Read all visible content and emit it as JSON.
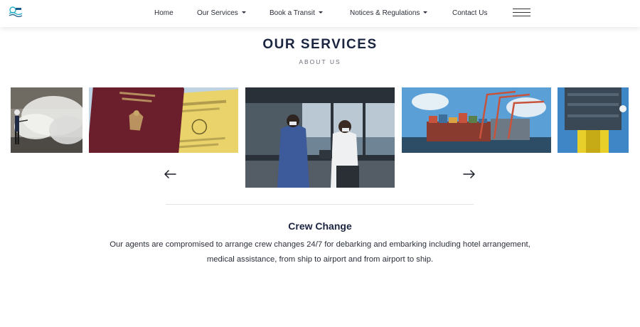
{
  "nav": {
    "home": "Home",
    "services": "Our Services",
    "book": "Book a Transit",
    "notices": "Notices & Regulations",
    "contact": "Contact Us"
  },
  "section": {
    "title": "OUR SERVICES",
    "subtitle": "ABOUT US"
  },
  "carousel": {
    "slides": [
      {
        "subject": "fumigation-worker"
      },
      {
        "subject": "passports-documents"
      },
      {
        "subject": "crew-on-bridge",
        "active": true
      },
      {
        "subject": "container-ship-port"
      },
      {
        "subject": "offshore-rig"
      }
    ]
  },
  "service": {
    "title": "Crew Change",
    "description": "Our agents are compromised to arrange crew changes 24/7 for debarking and embarking including hotel arrangement, medical assistance, from ship to airport and from airport to ship."
  },
  "colors": {
    "heading": "#1b2540",
    "text": "#2b2f3a",
    "passport": "#6b1f2c",
    "sky": "#5a9fd6",
    "crane": "#c8533c"
  }
}
